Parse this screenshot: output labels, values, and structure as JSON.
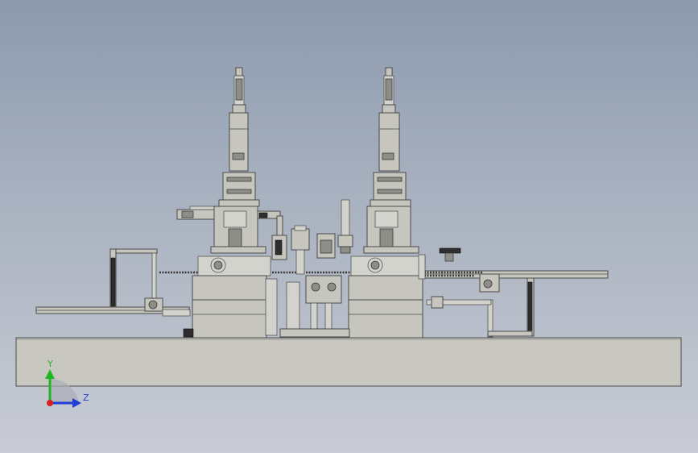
{
  "view": {
    "background_top": "#8c9aae",
    "background_bottom": "#c9ccd4"
  },
  "triad": {
    "y_label": "Y",
    "z_label": "Z",
    "y_color": "#1fb81f",
    "z_color": "#1f3fd8",
    "origin_color": "#d81f1f"
  }
}
